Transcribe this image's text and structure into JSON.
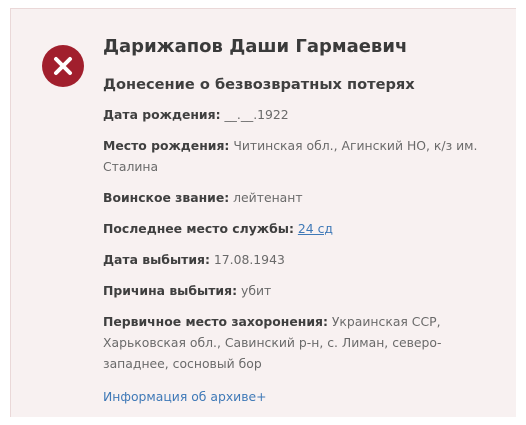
{
  "record": {
    "name": "Дарижапов Даши Гармаевич",
    "document_type": "Донесение о безвозвратных потерях",
    "fields": [
      {
        "label": "Дата рождения:",
        "value": "__.__.1922"
      },
      {
        "label": "Место рождения:",
        "value": "Читинская обл., Агинский НО, к/з им. Сталина"
      },
      {
        "label": "Воинское звание:",
        "value": "лейтенант"
      },
      {
        "label": "Последнее место службы:",
        "value": "24 сд"
      },
      {
        "label": "Дата выбытия:",
        "value": "17.08.1943"
      },
      {
        "label": "Причина выбытия:",
        "value": "убит"
      },
      {
        "label": "Первичное место захоронения:",
        "value": "Украинская ССР, Харьковская обл., Савинский р-н, с. Лиман, северо-западнее, сосновый бор"
      }
    ],
    "archive_link_label": "Информация об архиве+"
  },
  "status": {
    "icon": "close-icon",
    "color": "#a11f2d"
  }
}
